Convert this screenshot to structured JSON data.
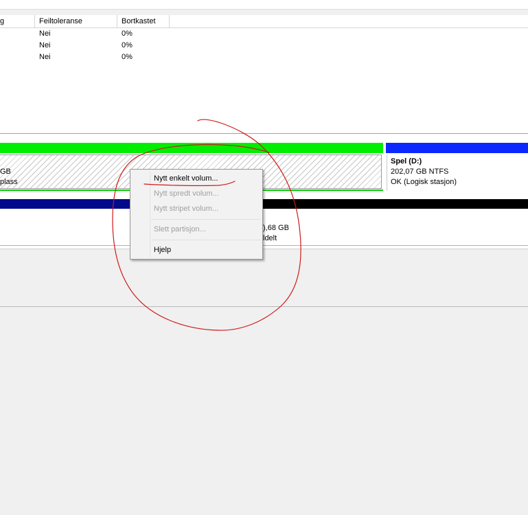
{
  "volume_list": {
    "columns": [
      "g",
      "Feiltoleranse",
      "Bortkastet"
    ],
    "rows": [
      [
        "",
        "Nei",
        "0%"
      ],
      [
        "",
        "Nei",
        "0%"
      ],
      [
        "",
        "Nei",
        "0%"
      ]
    ]
  },
  "disk1": {
    "unallocated": {
      "size": "GB",
      "label": "plass"
    },
    "volume": {
      "name": "Spel  (D:)",
      "size": "202,07 GB NTFS",
      "status": "OK (Logisk stasjon)"
    }
  },
  "disk2": {
    "size": "),68 GB",
    "label": "ldelt"
  },
  "context_menu": {
    "items": [
      {
        "label": "Nytt enkelt volum...",
        "enabled": true
      },
      {
        "label": "Nytt spredt volum...",
        "enabled": false
      },
      {
        "label": "Nytt stripet volum...",
        "enabled": false
      },
      {
        "label": "Slett partisjon...",
        "enabled": false
      },
      {
        "label": "Hjelp",
        "enabled": true
      }
    ]
  },
  "colors": {
    "primary_partition": "#00ee00",
    "logical_drive": "#0a28ff",
    "disk_header_navy": "#000a8a",
    "unallocated_black": "#000000",
    "annotation_red": "#d01818"
  }
}
